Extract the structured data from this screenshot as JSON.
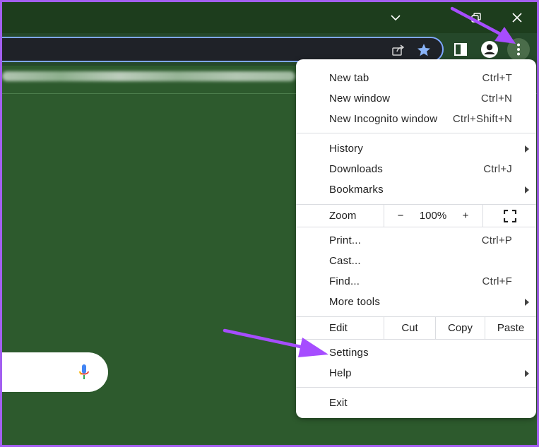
{
  "window": {
    "minimize_icon": "chevron-down-icon",
    "restore_icon": "restore-icon",
    "close_icon": "close-icon"
  },
  "toolbar": {
    "share_icon": "share-icon",
    "bookmark_icon": "star-icon",
    "side_panel_icon": "side-panel-icon",
    "profile_icon": "profile-icon",
    "menu_icon": "kebab-menu-icon"
  },
  "search": {
    "mic_icon": "microphone-icon"
  },
  "menu": {
    "group1": [
      {
        "label": "New tab",
        "accel": "Ctrl+T"
      },
      {
        "label": "New window",
        "accel": "Ctrl+N"
      },
      {
        "label": "New Incognito window",
        "accel": "Ctrl+Shift+N"
      }
    ],
    "group2": [
      {
        "label": "History",
        "accel": ""
      },
      {
        "label": "Downloads",
        "accel": "Ctrl+J"
      },
      {
        "label": "Bookmarks",
        "accel": ""
      }
    ],
    "zoom": {
      "label": "Zoom",
      "minus": "−",
      "value": "100%",
      "plus": "+",
      "fullscreen_icon": "fullscreen-icon"
    },
    "group3": [
      {
        "label": "Print...",
        "accel": "Ctrl+P"
      },
      {
        "label": "Cast...",
        "accel": ""
      },
      {
        "label": "Find...",
        "accel": "Ctrl+F"
      },
      {
        "label": "More tools",
        "accel": ""
      }
    ],
    "edit": {
      "label": "Edit",
      "cut": "Cut",
      "copy": "Copy",
      "paste": "Paste"
    },
    "group4": [
      {
        "label": "Settings"
      },
      {
        "label": "Help"
      }
    ],
    "exit": "Exit"
  },
  "colors": {
    "annotation_arrow": "#a64dff",
    "page_background": "#2d5a2d",
    "accent_border": "#7ea7ff"
  }
}
